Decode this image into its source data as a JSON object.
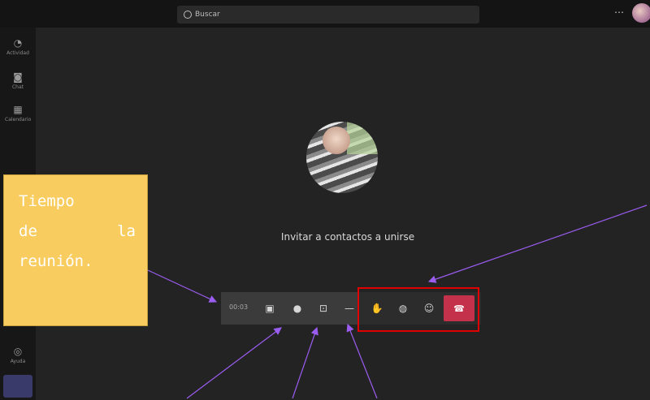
{
  "search": {
    "placeholder": "Buscar",
    "icon": "search-icon"
  },
  "rail": {
    "items": [
      {
        "icon": "bell-icon",
        "label": "Actividad"
      },
      {
        "icon": "chat-icon",
        "label": "Chat"
      },
      {
        "icon": "calendar-icon",
        "label": "Calendario"
      }
    ],
    "help_label": "Ayuda"
  },
  "meeting": {
    "invite_text": "Invitar a contactos a unirse",
    "timer": "00:03",
    "toolbar_icons": [
      "camera-icon",
      "microphone-icon",
      "share-screen-icon",
      "more-options-icon",
      "raise-hand-icon",
      "chat-icon",
      "participants-icon",
      "hang-up-icon"
    ]
  },
  "annotation": {
    "lines": [
      [
        "Tiempo"
      ],
      [
        "de",
        "la"
      ],
      [
        "reunión."
      ]
    ]
  },
  "colors": {
    "background": "#202020",
    "hangup": "#c4314b",
    "highlight_box": "#e00000",
    "arrow": "#9b5cf0",
    "note": "#f8cc5e"
  }
}
